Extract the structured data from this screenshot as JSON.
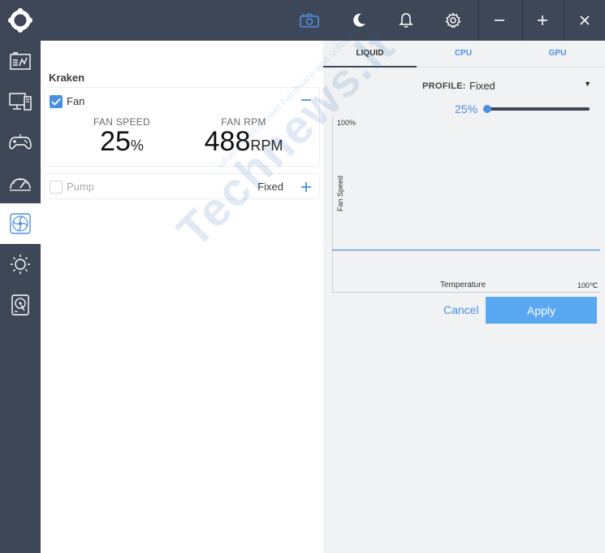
{
  "topbar": {
    "icons": [
      "logo-icon",
      "camera-icon",
      "moon-icon",
      "bell-icon",
      "gear-icon",
      "minimize-icon",
      "maximize-icon",
      "close-icon"
    ]
  },
  "sidebar": {
    "items": [
      {
        "icon": "dashboard-icon"
      },
      {
        "icon": "monitor-icon"
      },
      {
        "icon": "gamepad-icon"
      },
      {
        "icon": "speedometer-icon"
      },
      {
        "icon": "fan-icon",
        "active": true
      },
      {
        "icon": "sun-icon"
      },
      {
        "icon": "storage-icon"
      }
    ]
  },
  "device": {
    "title": "Kraken",
    "fan": {
      "label": "Fan",
      "checked": true,
      "speed_label": "FAN SPEED",
      "speed_value": "25",
      "speed_unit": "%",
      "rpm_label": "FAN RPM",
      "rpm_value": "488",
      "rpm_unit": "RPM"
    },
    "pump": {
      "label": "Pump",
      "checked": false,
      "mode": "Fixed"
    }
  },
  "tabs": [
    {
      "label": "LIQUID",
      "active": true
    },
    {
      "label": "CPU",
      "active": false
    },
    {
      "label": "GPU",
      "active": false
    }
  ],
  "profile": {
    "label": "PROFILE:",
    "value": "Fixed",
    "speed_percent": "25%",
    "speed_fraction": 0.25
  },
  "chart": {
    "y_top_label": "100%",
    "y_axis_label": "Fan Speed",
    "x_axis_label": "Temperature",
    "x_right_label": "100℃",
    "fixed_level": 25
  },
  "actions": {
    "cancel": "Cancel",
    "apply": "Apply"
  },
  "watermark": {
    "main": "Technews.lt",
    "sub": "where geeks meet hardware and software"
  },
  "colors": {
    "chrome": "#3e4757",
    "accent": "#4a90e2",
    "apply": "#5aa7f2",
    "panel": "#f1f2f3"
  }
}
